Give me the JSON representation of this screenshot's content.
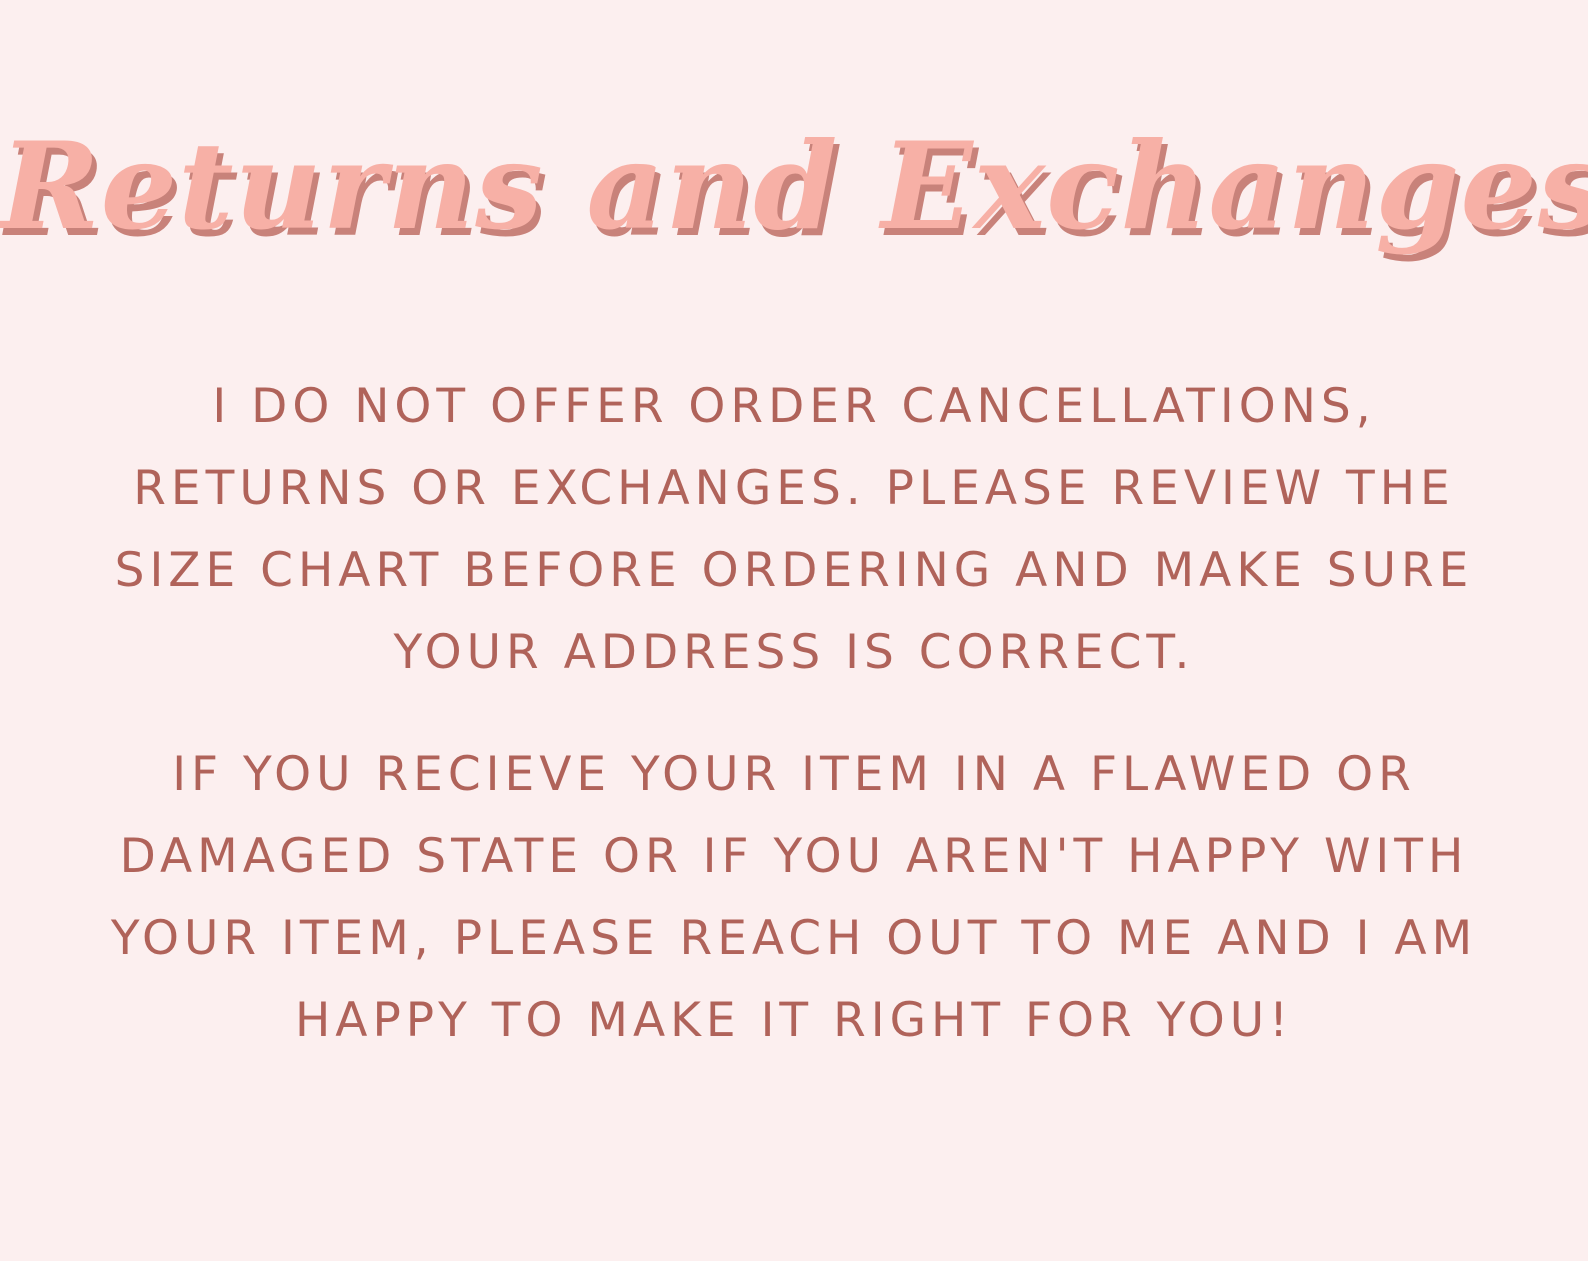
{
  "heading": "Returns and Exchanges",
  "paragraphs": [
    [
      "I DO NOT OFFER ORDER CANCELLATIONS,",
      "RETURNS OR EXCHANGES. PLEASE REVIEW THE",
      "SIZE CHART BEFORE ORDERING AND MAKE SURE",
      "YOUR ADDRESS IS CORRECT."
    ],
    [
      "IF YOU RECIEVE YOUR ITEM IN A FLAWED OR",
      "DAMAGED STATE OR IF YOU AREN'T HAPPY WITH",
      "YOUR ITEM, PLEASE REACH OUT TO ME AND I AM",
      "HAPPY TO MAKE IT RIGHT FOR YOU!"
    ]
  ],
  "colors": {
    "background": "#fcefef",
    "heading": "#f7b0a6",
    "heading_shadow": "#c8827a",
    "body_text": "#b0635a"
  }
}
